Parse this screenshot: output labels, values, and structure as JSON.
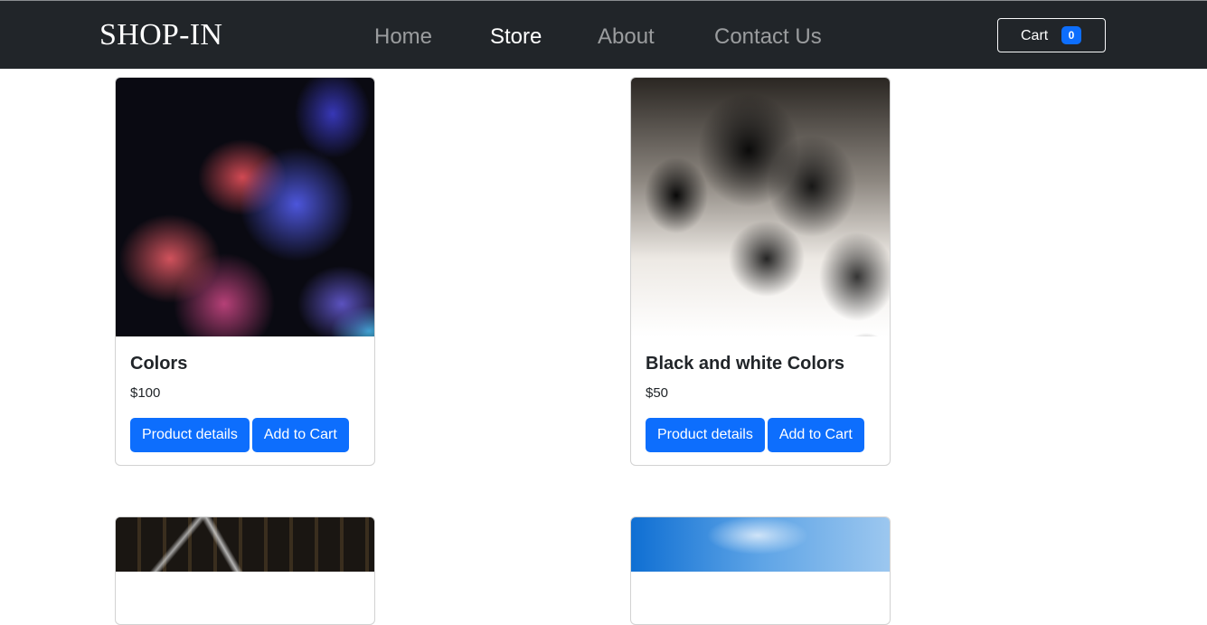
{
  "navbar": {
    "brand": "SHOP-IN",
    "links": [
      {
        "label": "Home",
        "active": false
      },
      {
        "label": "Store",
        "active": true
      },
      {
        "label": "About",
        "active": false
      },
      {
        "label": "Contact Us",
        "active": false
      }
    ],
    "cart": {
      "label": "Cart",
      "count": "0"
    }
  },
  "products": [
    {
      "title": "Colors",
      "price": "$100",
      "details_label": "Product details",
      "add_label": "Add to Cart"
    },
    {
      "title": "Black and white Colors",
      "price": "$50",
      "details_label": "Product details",
      "add_label": "Add to Cart"
    }
  ],
  "colors": {
    "navbar_bg": "#212529",
    "accent": "#0d6efd",
    "nav_active": "#ffffff",
    "nav_inactive": "rgba(255,255,255,0.55)"
  }
}
